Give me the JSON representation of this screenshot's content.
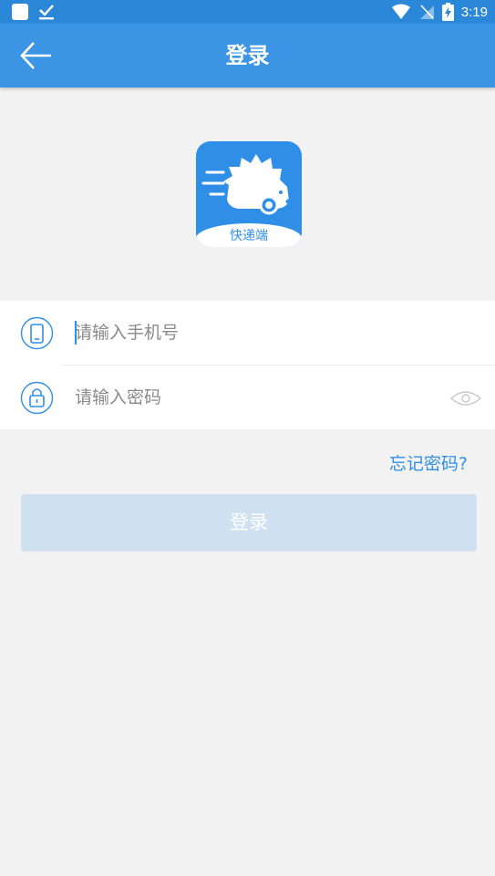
{
  "statusbar": {
    "time": "3:19",
    "icons": [
      "app-square-icon",
      "checkbox-icon",
      "wifi-icon",
      "no-sim-icon",
      "battery-charging-icon"
    ]
  },
  "appbar": {
    "title": "登录",
    "back_icon": "arrow-left-icon",
    "color": "#3b95e4"
  },
  "logo": {
    "text": "快递端",
    "icon": "hedgehog-delivery-icon",
    "color": "#2f8fe6"
  },
  "form": {
    "phone": {
      "placeholder": "请输入手机号",
      "value": "",
      "icon": "phone-icon"
    },
    "password": {
      "placeholder": "请输入密码",
      "value": "",
      "icon": "lock-icon",
      "toggle_icon": "eye-icon"
    }
  },
  "forgot_password": "忘记密码?",
  "login_button": {
    "label": "登录",
    "state": "disabled",
    "color": "#cfe0f1"
  },
  "colors": {
    "accent": "#2f8fe6",
    "background": "#f2f2f2"
  }
}
